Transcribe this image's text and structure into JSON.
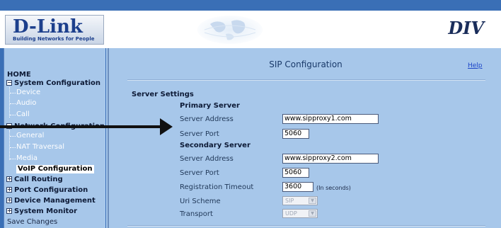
{
  "header": {
    "logo_main": "D-Link",
    "logo_tagline": "Building Networks for People",
    "brand_right": "DIV"
  },
  "sidebar": {
    "items": [
      {
        "label": "HOME"
      },
      {
        "label": "System Configuration",
        "expand": "−"
      },
      {
        "label": "Device"
      },
      {
        "label": "Audio"
      },
      {
        "label": "Call"
      },
      {
        "label": "Network Configuration",
        "expand": "−"
      },
      {
        "label": "General"
      },
      {
        "label": "NAT Traversal"
      },
      {
        "label": "Media"
      },
      {
        "label": "VoIP Configuration"
      },
      {
        "label": "Call Routing",
        "expand": "+"
      },
      {
        "label": "Port Configuration",
        "expand": "+"
      },
      {
        "label": "Device Management",
        "expand": "+"
      },
      {
        "label": "System Monitor",
        "expand": "+"
      },
      {
        "label": "Save Changes"
      }
    ]
  },
  "main": {
    "title": "SIP Configuration",
    "help_label": "Help",
    "server_settings_label": "Server Settings",
    "primary": {
      "heading": "Primary Server",
      "address_label": "Server Address",
      "address_value": "www.sipproxy1.com",
      "port_label": "Server Port",
      "port_value": "5060"
    },
    "secondary": {
      "heading": "Secondary Server",
      "address_label": "Server Address",
      "address_value": "www.sipproxy2.com",
      "port_label": "Server Port",
      "port_value": "5060"
    },
    "registration_timeout_label": "Registration Timeout",
    "registration_timeout_value": "3600",
    "registration_timeout_unit": "(In seconds)",
    "uri_scheme_label": "Uri Scheme",
    "uri_scheme_value": "SIP",
    "transport_label": "Transport",
    "transport_value": "UDP",
    "select_arrow": "▼"
  },
  "colors": {
    "top_bar": "#3a6fb6",
    "panel": "#a7c7ea",
    "link": "#1b44c8"
  }
}
